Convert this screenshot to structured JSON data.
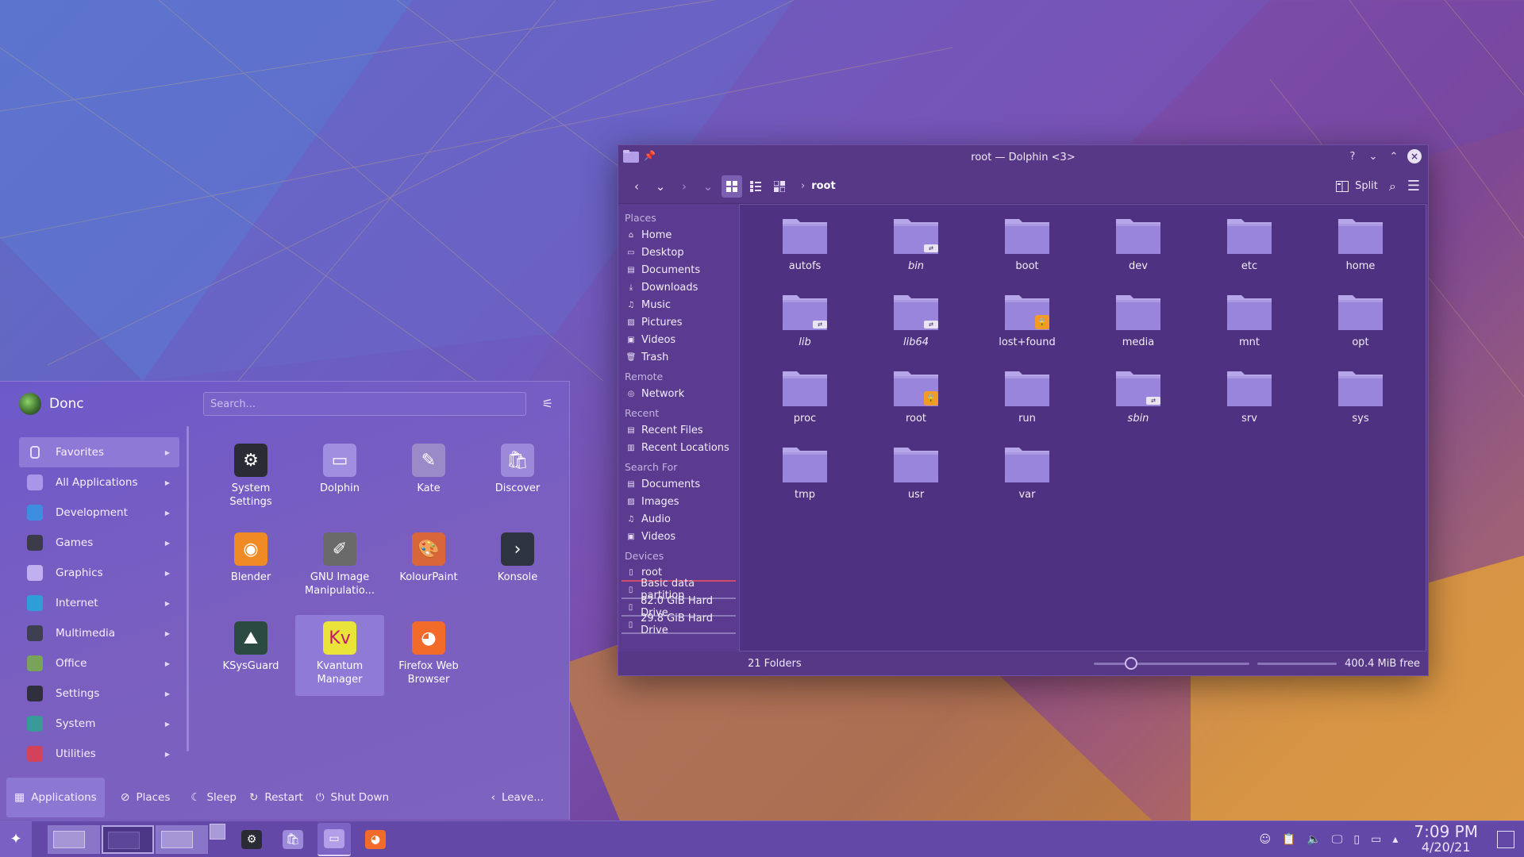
{
  "colors": {
    "folder": "#9a85dc",
    "folder_tab": "#b7a6ea",
    "accent": "#8e79d7",
    "lock_badge": "#f29b29",
    "device_active_bar": "#d14a6a"
  },
  "dolphin": {
    "title": "root — Dolphin <3>",
    "breadcrumb": "root",
    "split_label": "Split",
    "places_sections": [
      {
        "label": "Places",
        "items": [
          {
            "label": "Home",
            "icon": "home-icon"
          },
          {
            "label": "Desktop",
            "icon": "desktop-icon"
          },
          {
            "label": "Documents",
            "icon": "document-icon"
          },
          {
            "label": "Downloads",
            "icon": "download-icon"
          },
          {
            "label": "Music",
            "icon": "music-icon"
          },
          {
            "label": "Pictures",
            "icon": "picture-icon"
          },
          {
            "label": "Videos",
            "icon": "video-icon"
          },
          {
            "label": "Trash",
            "icon": "trash-icon"
          }
        ]
      },
      {
        "label": "Remote",
        "items": [
          {
            "label": "Network",
            "icon": "network-icon"
          }
        ]
      },
      {
        "label": "Recent",
        "items": [
          {
            "label": "Recent Files",
            "icon": "recent-files-icon"
          },
          {
            "label": "Recent Locations",
            "icon": "recent-locations-icon"
          }
        ]
      },
      {
        "label": "Search For",
        "items": [
          {
            "label": "Documents",
            "icon": "document-icon"
          },
          {
            "label": "Images",
            "icon": "picture-icon"
          },
          {
            "label": "Audio",
            "icon": "music-icon"
          },
          {
            "label": "Videos",
            "icon": "video-icon"
          }
        ]
      },
      {
        "label": "Devices",
        "items": [
          {
            "label": "root",
            "icon": "drive-icon"
          },
          {
            "label": "Basic data partition",
            "icon": "drive-icon"
          },
          {
            "label": "82.0 GiB Hard Drive",
            "icon": "drive-icon"
          },
          {
            "label": "29.8 GiB Hard Drive",
            "icon": "drive-icon"
          }
        ]
      }
    ],
    "folders": [
      {
        "name": "autofs",
        "italic": false,
        "badge": ""
      },
      {
        "name": "bin",
        "italic": true,
        "badge": "link"
      },
      {
        "name": "boot",
        "italic": false,
        "badge": ""
      },
      {
        "name": "dev",
        "italic": false,
        "badge": ""
      },
      {
        "name": "etc",
        "italic": false,
        "badge": ""
      },
      {
        "name": "home",
        "italic": false,
        "badge": ""
      },
      {
        "name": "lib",
        "italic": true,
        "badge": "link"
      },
      {
        "name": "lib64",
        "italic": true,
        "badge": "link"
      },
      {
        "name": "lost+found",
        "italic": false,
        "badge": "lock"
      },
      {
        "name": "media",
        "italic": false,
        "badge": ""
      },
      {
        "name": "mnt",
        "italic": false,
        "badge": ""
      },
      {
        "name": "opt",
        "italic": false,
        "badge": ""
      },
      {
        "name": "proc",
        "italic": false,
        "badge": ""
      },
      {
        "name": "root",
        "italic": false,
        "badge": "lock"
      },
      {
        "name": "run",
        "italic": false,
        "badge": ""
      },
      {
        "name": "sbin",
        "italic": true,
        "badge": "link"
      },
      {
        "name": "srv",
        "italic": false,
        "badge": ""
      },
      {
        "name": "sys",
        "italic": false,
        "badge": ""
      },
      {
        "name": "tmp",
        "italic": false,
        "badge": ""
      },
      {
        "name": "usr",
        "italic": false,
        "badge": ""
      },
      {
        "name": "var",
        "italic": false,
        "badge": ""
      }
    ],
    "status": {
      "count": "21 Folders",
      "zoom_fraction": 0.24,
      "free": "400.4 MiB free"
    }
  },
  "launcher": {
    "user": "Donc",
    "search_placeholder": "Search...",
    "categories": [
      {
        "label": "Favorites",
        "icon": "bookmark-icon",
        "color": "#8e79d7"
      },
      {
        "label": "All Applications",
        "icon": "grid-icon",
        "color": "#a996e8"
      },
      {
        "label": "Development",
        "icon": "development-icon",
        "color": "#3d8ee0"
      },
      {
        "label": "Games",
        "icon": "gamepad-icon",
        "color": "#3b3b4a"
      },
      {
        "label": "Graphics",
        "icon": "graphics-icon",
        "color": "#c0b0ef"
      },
      {
        "label": "Internet",
        "icon": "globe-icon",
        "color": "#2e9fd6"
      },
      {
        "label": "Multimedia",
        "icon": "multimedia-icon",
        "color": "#3f3f52"
      },
      {
        "label": "Office",
        "icon": "office-icon",
        "color": "#7aa35a"
      },
      {
        "label": "Settings",
        "icon": "settings-icon",
        "color": "#2f2f3d"
      },
      {
        "label": "System",
        "icon": "system-icon",
        "color": "#3a9a9a"
      },
      {
        "label": "Utilities",
        "icon": "toolbox-icon",
        "color": "#d2425b"
      }
    ],
    "apps": [
      {
        "label": "System Settings",
        "icon": "system-settings-icon",
        "color": "#2b2b35"
      },
      {
        "label": "Dolphin",
        "icon": "dolphin-icon",
        "color": "#a08ee0"
      },
      {
        "label": "Kate",
        "icon": "kate-icon",
        "color": "#9a8ac8"
      },
      {
        "label": "Discover",
        "icon": "discover-icon",
        "color": "#9d89d9"
      },
      {
        "label": "Blender",
        "icon": "blender-icon",
        "color": "#f08a24"
      },
      {
        "label": "GNU Image Manipulatio...",
        "icon": "gimp-icon",
        "color": "#6a6a6a"
      },
      {
        "label": "KolourPaint",
        "icon": "kolourpaint-icon",
        "color": "#d9663a"
      },
      {
        "label": "Konsole",
        "icon": "konsole-icon",
        "color": "#2e3540"
      },
      {
        "label": "KSysGuard",
        "icon": "ksysguard-icon",
        "color": "#2b4a42"
      },
      {
        "label": "Kvantum Manager",
        "icon": "kvantum-icon",
        "color": "#e9e33a"
      },
      {
        "label": "Firefox Web Browser",
        "icon": "firefox-icon",
        "color": "#f26b2a"
      }
    ],
    "footer": {
      "tab_applications": "Applications",
      "tab_places": "Places",
      "sleep": "Sleep",
      "restart": "Restart",
      "shutdown": "Shut Down",
      "leave": "Leave..."
    }
  },
  "taskbar": {
    "time": "7:09 PM",
    "date": "4/20/21",
    "tasks": [
      {
        "name": "system-settings-task",
        "icon": "system-settings-icon"
      },
      {
        "name": "discover-task",
        "icon": "discover-icon"
      },
      {
        "name": "dolphin-task",
        "icon": "dolphin-icon"
      },
      {
        "name": "firefox-task",
        "icon": "firefox-icon"
      }
    ],
    "tray": [
      "accessibility-icon",
      "clipboard-icon",
      "volume-icon",
      "network-icon",
      "battery-icon",
      "display-icon",
      "tray-expand-icon"
    ]
  }
}
